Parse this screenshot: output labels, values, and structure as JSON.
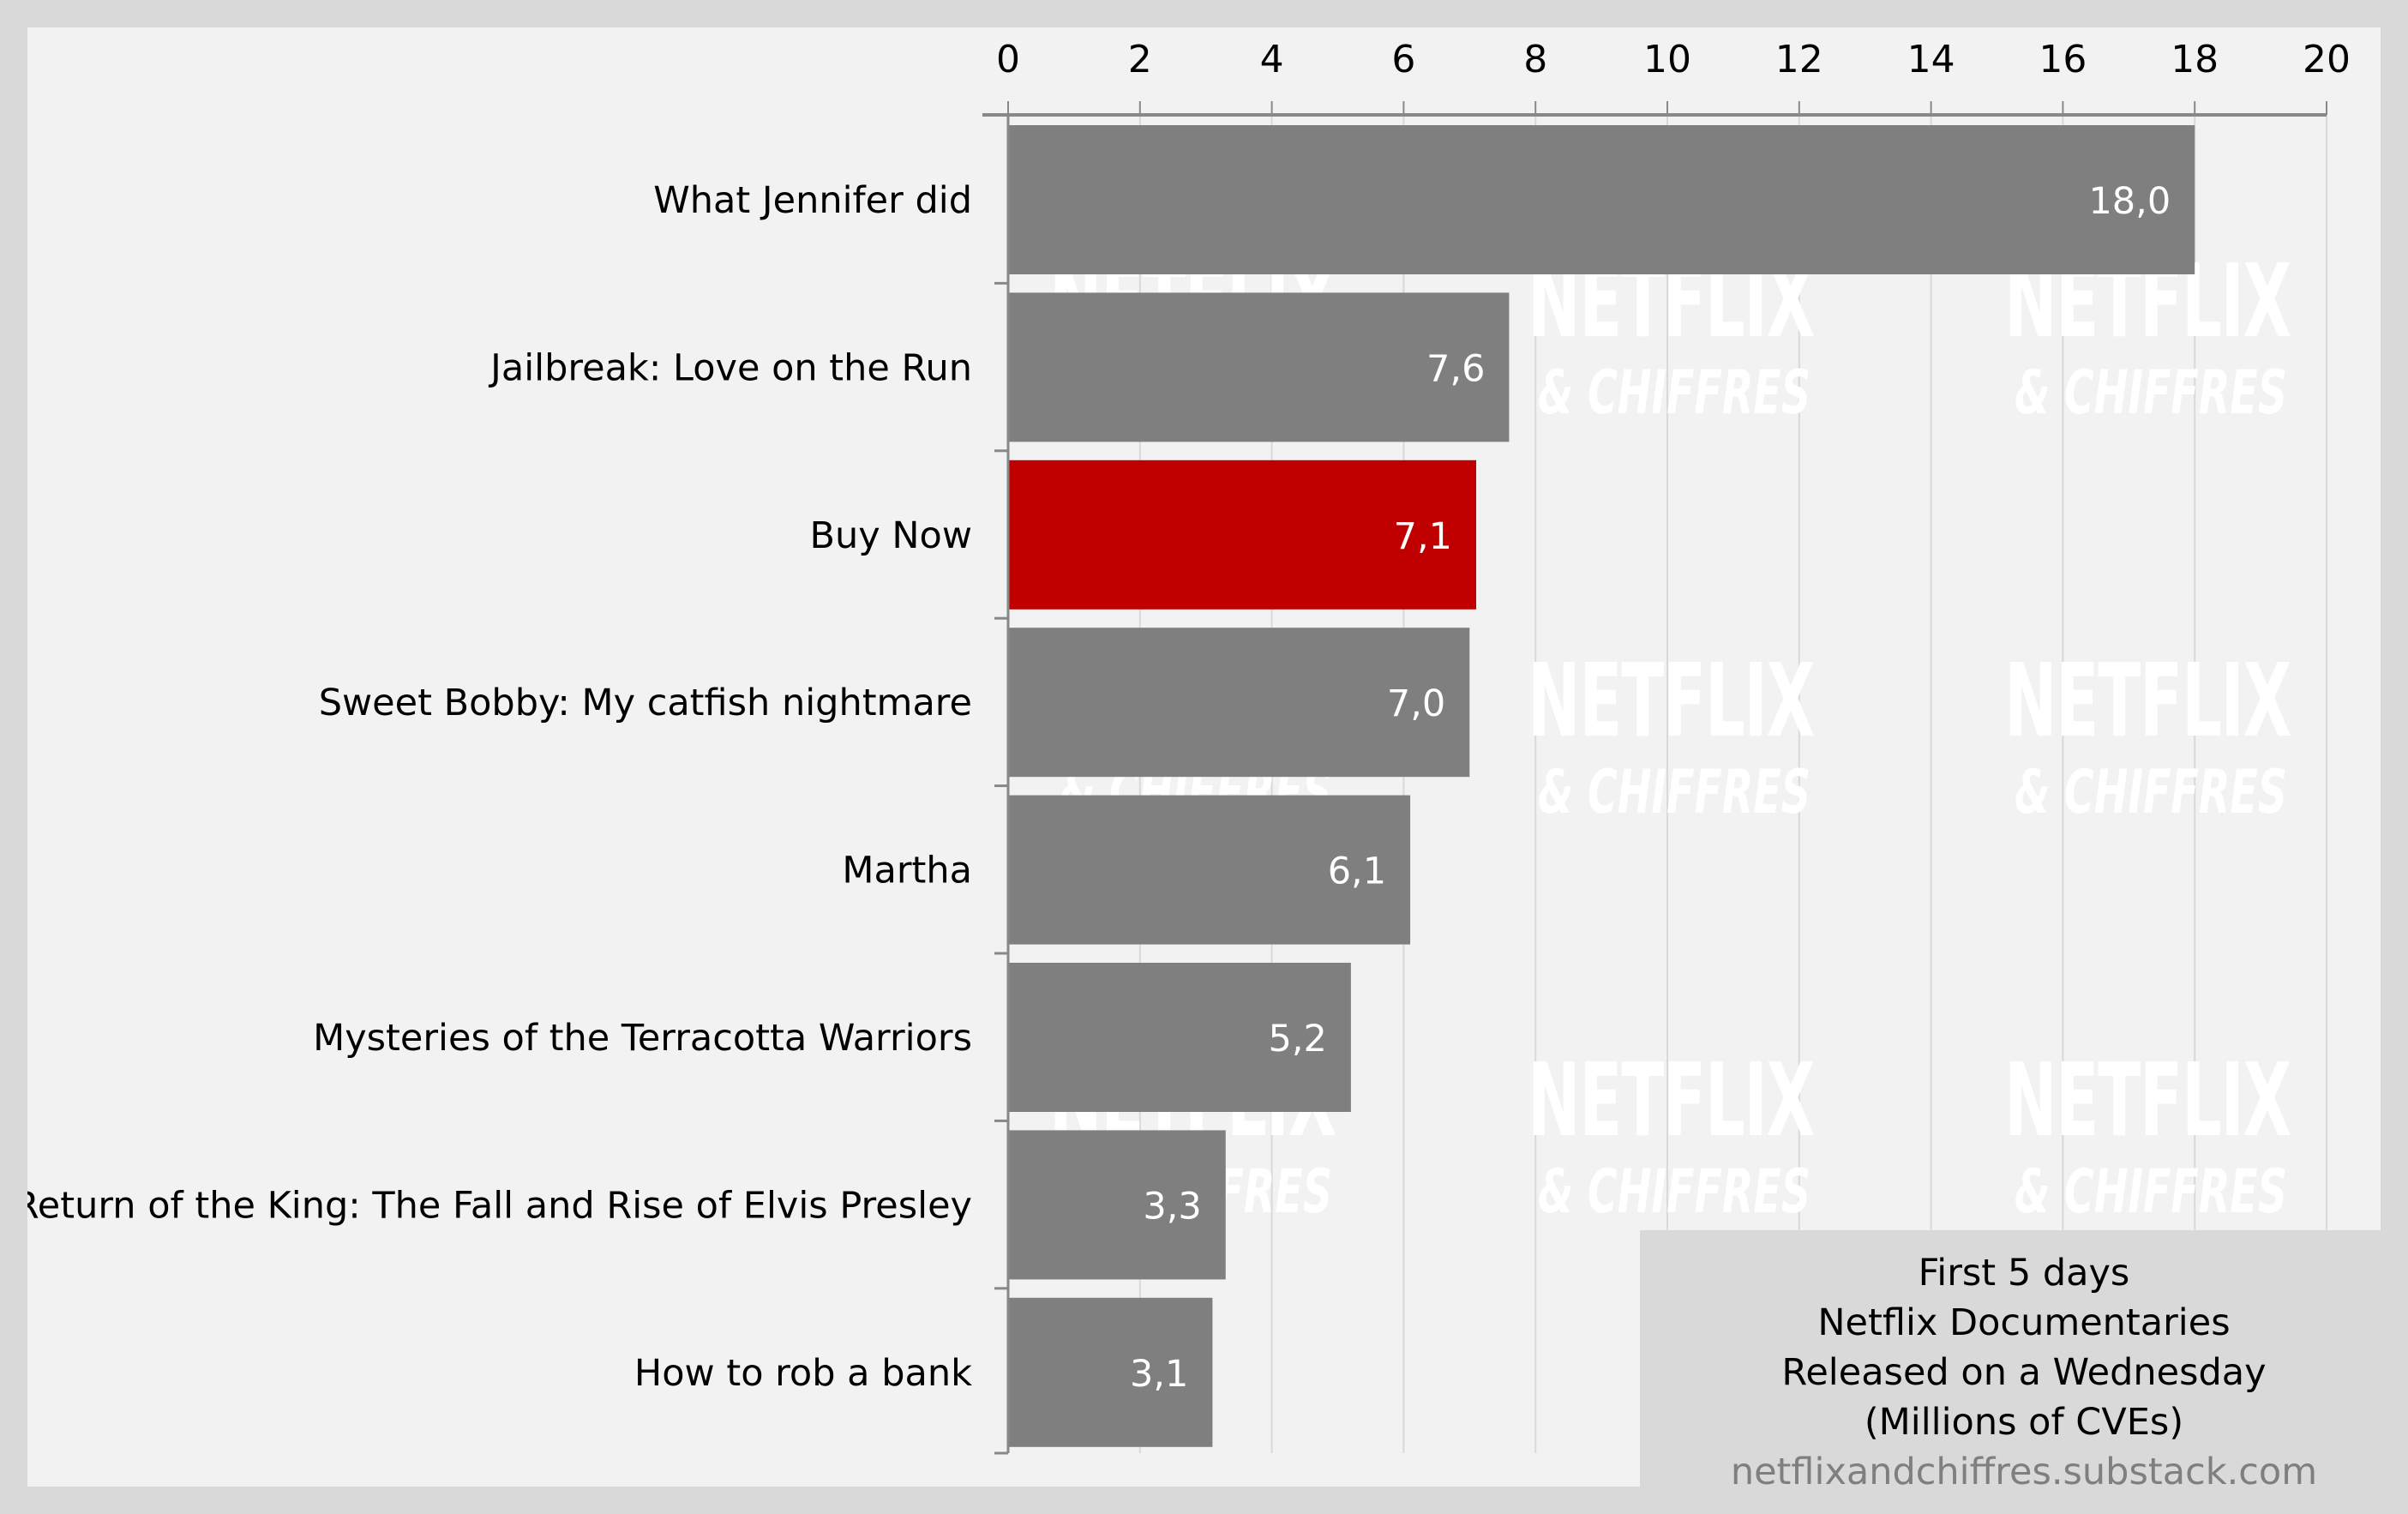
{
  "chart_data": {
    "type": "bar",
    "orientation": "horizontal",
    "categories": [
      "What Jennifer did",
      "Jailbreak: Love on the Run",
      "Buy Now",
      "Sweet Bobby: My catfish nightmare",
      "Martha",
      "Mysteries of the Terracotta Warriors",
      "Return of the King: The Fall and Rise of Elvis Presley",
      "How to rob a bank"
    ],
    "values": [
      18.0,
      7.6,
      7.1,
      7.0,
      6.1,
      5.2,
      3.3,
      3.1
    ],
    "value_labels": [
      "18,0",
      "7,6",
      "7,1",
      "7,0",
      "6,1",
      "5,2",
      "3,3",
      "3,1"
    ],
    "highlight_index": 2,
    "colors": {
      "default": "#7f7f7f",
      "highlight": "#c00000",
      "value_label": "#ffffff"
    },
    "xlim": [
      0,
      20
    ],
    "xticks": [
      0,
      2,
      4,
      6,
      8,
      10,
      12,
      14,
      16,
      18,
      20
    ],
    "xaxis_position": "top",
    "grid": true,
    "title": "",
    "xlabel": "",
    "ylabel": "",
    "legend_box": {
      "position": "bottom-right",
      "lines": [
        "First 5 days",
        "Netflix Documentaries",
        "Released on a Wednesday",
        "(Millions of CVEs)"
      ],
      "source": "netflixandchiffres.substack.com"
    },
    "watermark": {
      "line1": "NETFLIX",
      "line2": "& CHIFFRES"
    }
  }
}
